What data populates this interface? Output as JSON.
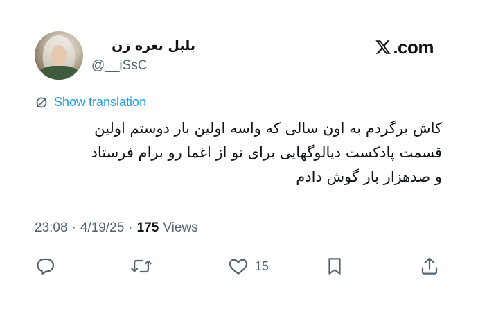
{
  "author": {
    "display_name": "بلبل نعره زن",
    "handle": "@__iSsC"
  },
  "brand": {
    "text": ".com"
  },
  "translation": {
    "label": "Show translation"
  },
  "tweet": {
    "lines": [
      "کاش برگردم به اون سالی که واسه اولین بار دوستم اولین",
      "قسمت پادکست دیالوگهایی برای تو از اغما رو برام فرستاد",
      "و صدهزار بار گوش دادم"
    ]
  },
  "meta": {
    "time": "23:08",
    "separator1": "·",
    "date": "4/19/25",
    "separator2": "·",
    "views_count": "175",
    "views_label": "Views"
  },
  "actions": {
    "like_count": "15"
  },
  "icons": {
    "reply": "reply-icon",
    "retweet": "retweet-icon",
    "like": "heart-icon",
    "bookmark": "bookmark-icon",
    "share": "share-icon",
    "translate": "translate-icon",
    "brand": "x-logo-icon"
  },
  "colors": {
    "text": "#0f1419",
    "secondary": "#536471",
    "link": "#1d9bf0"
  }
}
